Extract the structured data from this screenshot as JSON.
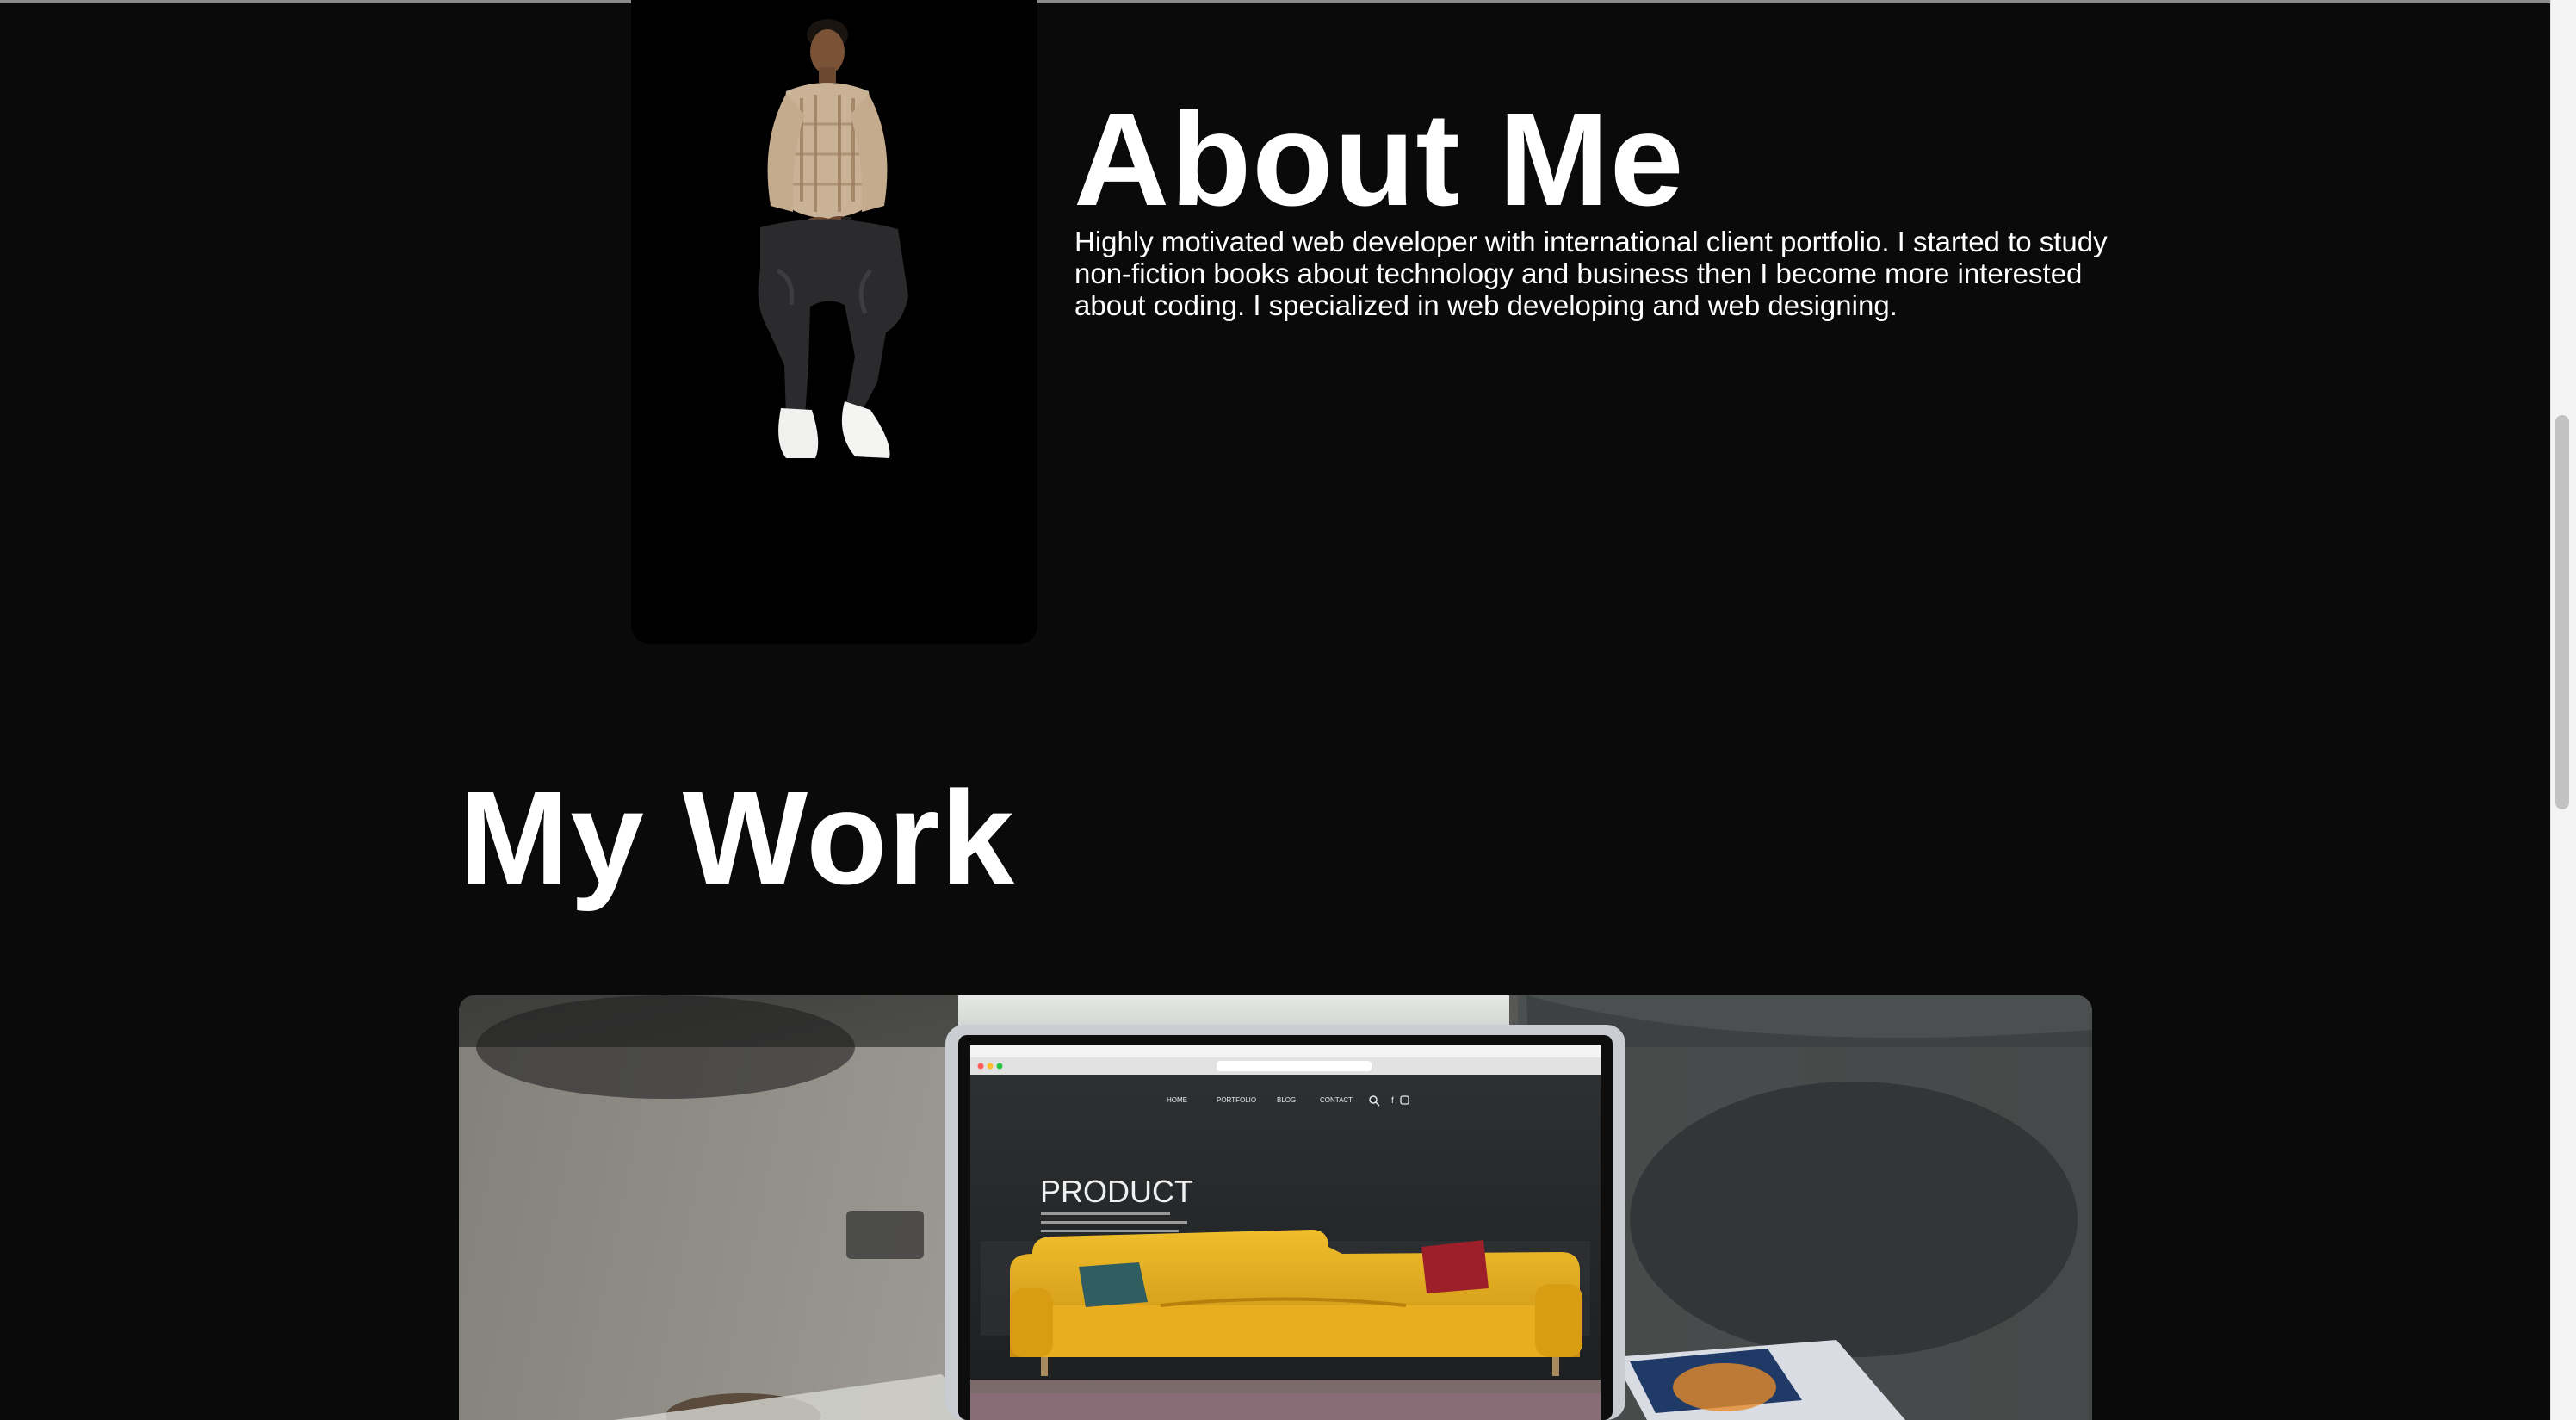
{
  "about": {
    "title": "About Me",
    "description": "Highly motivated web developer with international client portfolio. I started to study non-fiction books about technology and business then I become more interested about coding. I specialized in web developing and web designing."
  },
  "work": {
    "title": "My Work",
    "project_screen": {
      "nav_items": [
        "HOME",
        "PORTFOLIO",
        "BLOG",
        "CONTACT"
      ],
      "hero_title": "PRODUCT"
    }
  },
  "colors": {
    "page_background": "#0a0a0a",
    "text": "#ffffff",
    "card_background": "#000000",
    "scrollbar_thumb": "#c2c2c2"
  },
  "icons": [
    "person-photo",
    "search-icon",
    "facebook-icon",
    "instagram-icon"
  ]
}
